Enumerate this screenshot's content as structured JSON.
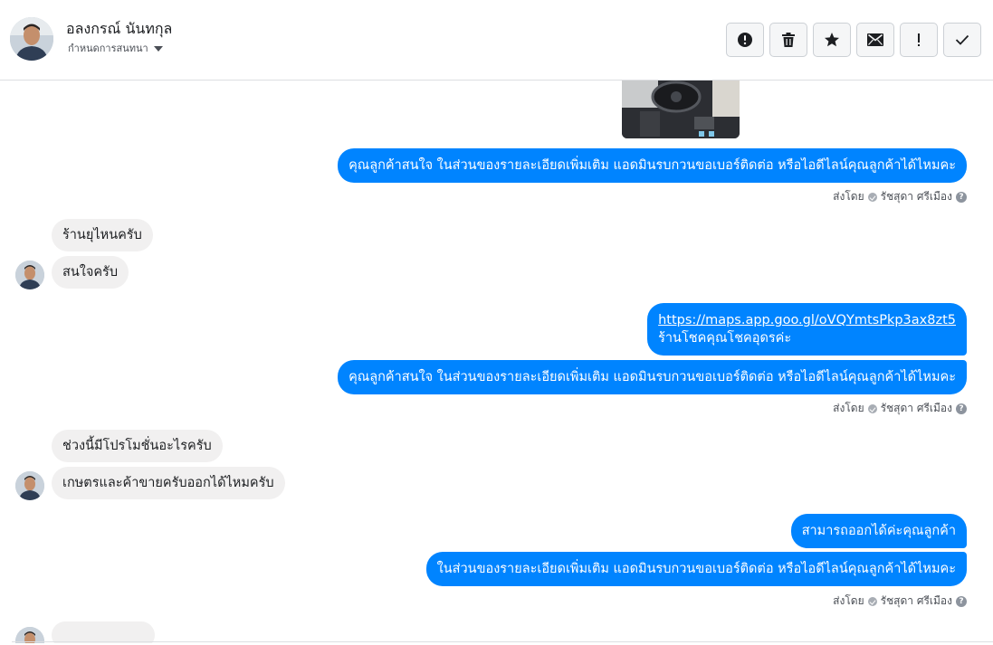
{
  "header": {
    "contact_name": "อลงกรณ์ นันทกุล",
    "assign_label": "กำหนดการสนทนา",
    "actions": [
      {
        "name": "spam-report",
        "icon": "exclamation-circle-icon"
      },
      {
        "name": "delete",
        "icon": "trash-icon"
      },
      {
        "name": "star",
        "icon": "star-icon"
      },
      {
        "name": "mark-unread",
        "icon": "envelope-icon"
      },
      {
        "name": "follow-up",
        "icon": "exclamation-icon"
      },
      {
        "name": "mark-done",
        "icon": "checkmark-icon"
      }
    ]
  },
  "messages": {
    "out1": "คุณลูกค้าสนใจ ในส่วนของรายละเอียดเพิ่มเติม แอดมินรบกวนขอเบอร์ติดต่อ หรือไอดีไลน์คุณลูกค้าได้ไหมคะ",
    "in1": "ร้านยุไหนครับ",
    "in2": "สนใจครับ",
    "out2_link": "https://maps.app.goo.gl/oVQYmtsPkp3ax8zt5",
    "out2_text": "ร้านโชคคุณโชคอุดรค่ะ",
    "out3": "คุณลูกค้าสนใจ ในส่วนของรายละเอียดเพิ่มเติม แอดมินรบกวนขอเบอร์ติดต่อ หรือไอดีไลน์คุณลูกค้าได้ไหมคะ",
    "in3": "ช่วงนี้มีโปรโมชั่นอะไรครับ",
    "in4": "เกษตรและค้าขายครับออกได้ไหมครับ",
    "out4": "สามารถออกได้ค่ะคุณลูกค้า",
    "out5": "ในส่วนของรายละเอียดเพิ่มเติม แอดมินรบกวนขอเบอร์ติดต่อ หรือไอดีไลน์คุณลูกค้าได้ไหมคะ"
  },
  "sent_by": {
    "label": "ส่งโดย",
    "agent": "รัชสุดา ศรีเมือง"
  },
  "colors": {
    "outgoing_bubble": "#0084ff",
    "incoming_bubble": "#f1f0f0"
  }
}
